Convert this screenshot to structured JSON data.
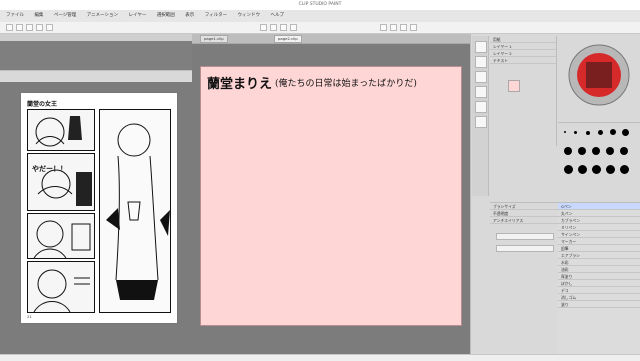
{
  "app": {
    "title": "CLIP STUDIO PAINT",
    "menu": [
      "ファイル",
      "編集",
      "ページ管理",
      "アニメーション",
      "レイヤー",
      "選択範囲",
      "表示",
      "フィルター",
      "ウィンドウ",
      "ヘルプ"
    ]
  },
  "canvas": {
    "main_text": "蘭堂まりえ",
    "main_subtext": "(俺たちの日常は始まったばかりだ)"
  },
  "manga": {
    "title": "蘭堂の女王",
    "shout": "やだー！！",
    "page_number": "21"
  },
  "tabs": [
    "page1.clip",
    "page2.clip"
  ],
  "right_panel": {
    "layers": [
      "用紙",
      "レイヤー 1",
      "レイヤー 2",
      "テキスト"
    ],
    "props": [
      "ブラシサイズ",
      "不透明度",
      "アンチエイリアス"
    ],
    "list": [
      "Gペン",
      "丸ペン",
      "カブラペン",
      "ミリペン",
      "サインペン",
      "マーカー",
      "鉛筆",
      "エアブラシ",
      "水彩",
      "油彩",
      "厚塗り",
      "ぼかし",
      "デコ",
      "消しゴム",
      "塗り"
    ]
  },
  "colors": {
    "canvas_pink": "#ffd6d6",
    "workspace_gray": "#7c7c7c"
  }
}
